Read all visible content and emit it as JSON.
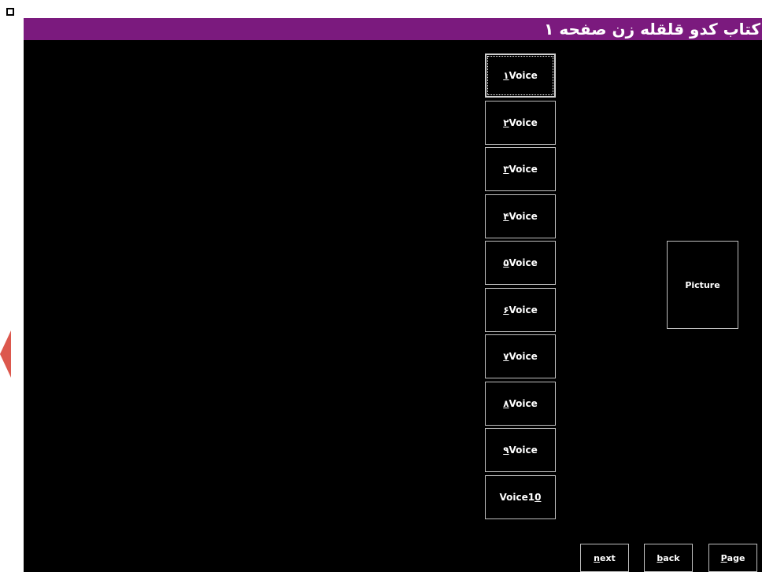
{
  "window": {
    "title": "کتاب کدو قلقله زن صفحه ۱"
  },
  "voice_buttons": [
    {
      "digit": "۱",
      "label": "Voice",
      "focused": true
    },
    {
      "digit": "۲",
      "label": "Voice"
    },
    {
      "digit": "۳",
      "label": "Voice"
    },
    {
      "digit": "۴",
      "label": "Voice"
    },
    {
      "digit": "۵",
      "label": "Voice"
    },
    {
      "digit": "۶",
      "label": "Voice"
    },
    {
      "digit": "۷",
      "label": "Voice"
    },
    {
      "digit": "۸",
      "label": "Voice"
    },
    {
      "digit": "۹",
      "label": "Voice"
    },
    {
      "label": "Voice1",
      "digit": "0"
    }
  ],
  "picture": {
    "label": "Picture"
  },
  "nav": {
    "next": {
      "key": "n",
      "rest": "ext"
    },
    "back": {
      "key": "b",
      "rest": "ack"
    },
    "page": {
      "key": "P",
      "rest": "age"
    }
  },
  "colors": {
    "title_bar": "#7b1a7e",
    "background": "#000000",
    "button_border": "#bfbfbf",
    "text": "#ffffff"
  }
}
